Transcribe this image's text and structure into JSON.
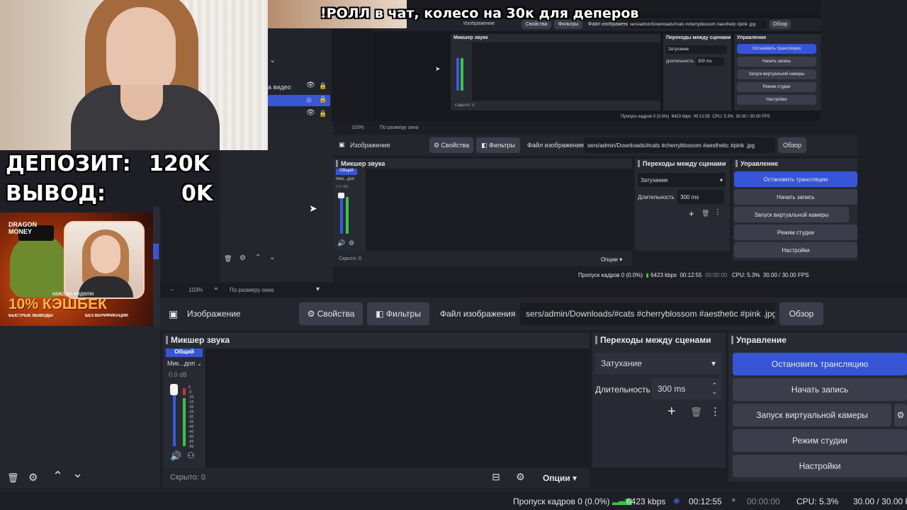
{
  "overlay": {
    "ticker": "!РОЛЛ в чат, колесо на 30к для деперов",
    "deposit_label": "ДЕПОЗИТ:",
    "deposit_value": "120K",
    "withdraw_label": "ВЫВОД:",
    "withdraw_value": "0K"
  },
  "promo": {
    "brand_line1": "DRAGON",
    "brand_line2": "MONEY",
    "weekly": "каждую неделю",
    "cashback": "10% КЭШБЕК",
    "fast": "БЫСТРЫЕ ВЫВОДЫ",
    "no_verify": "БЕЗ ВЕРИФИКАЦИИ"
  },
  "sources": {
    "item_partial": "а видео"
  },
  "obs": {
    "zoom": "103%",
    "zoom_mode": "По размеру окна",
    "source_name": "Изображение",
    "properties_label": "Свойства",
    "filters_label": "Фильтры",
    "file_label": "Файл изображения",
    "file_path": "sers/admin/Downloads/#cats #cherryblossom #aesthetic #pink .jpg",
    "browse_label": "Обзор",
    "mixer_title": "Микшер звука",
    "mixer_tab": "Общий",
    "mixer_channel": "Мик...доп",
    "mixer_db": "0.0 dB",
    "meter_ticks": [
      "0",
      "-5",
      "-10",
      "-15",
      "-20",
      "-25",
      "-30",
      "-35",
      "-40",
      "-45",
      "-50",
      "-55",
      "-60"
    ],
    "hidden_label": "Скрыто: 0",
    "options_label": "Опции",
    "transitions_title": "Переходы между сценами",
    "transition_value": "Затухание",
    "duration_label": "Длительность",
    "duration_value": "300 ms",
    "controls_title": "Управление",
    "stop_stream": "Остановить трансляцию",
    "start_record": "Начать запись",
    "virtual_cam": "Запуск виртуальной камеры",
    "studio_mode": "Режим студии",
    "settings": "Настройки",
    "dropped_frames": "Пропуск кадров 0 (0.0%)",
    "bitrate": "6423 kbps",
    "live_time": "00:12:55",
    "rec_time": "00:00:00",
    "cpu": "CPU: 5.3%",
    "fps": "30.00 / 30.00 FPS"
  },
  "colors": {
    "accent_blue": "#3655d6",
    "meter_green": "#3cc24a",
    "meter_blue": "#3a5bd8",
    "panel": "#272a33"
  }
}
